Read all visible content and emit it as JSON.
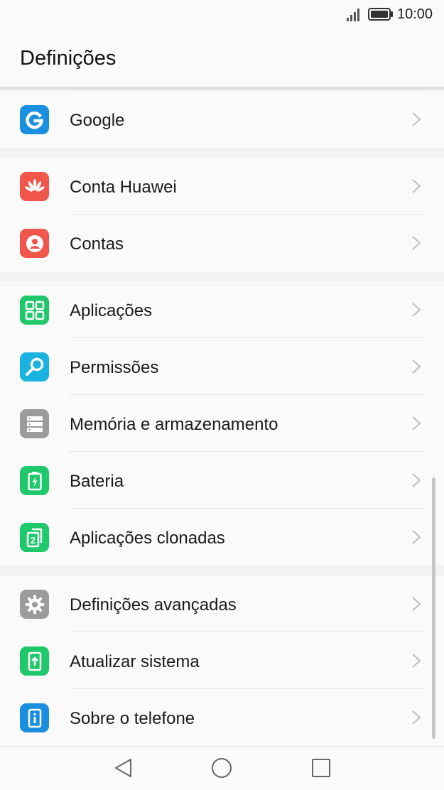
{
  "status_bar": {
    "time": "10:00",
    "signal_icon": "signal-icon",
    "battery_icon": "battery-icon"
  },
  "header": {
    "title": "Definições"
  },
  "groups": [
    {
      "items": [
        {
          "label": "Google",
          "icon": "google-icon",
          "color": "#1a8fe0"
        }
      ]
    },
    {
      "items": [
        {
          "label": "Conta Huawei",
          "icon": "huawei-icon",
          "color": "#f0574a"
        },
        {
          "label": "Contas",
          "icon": "account-icon",
          "color": "#f0574a"
        }
      ]
    },
    {
      "items": [
        {
          "label": "Aplicações",
          "icon": "apps-icon",
          "color": "#1fc96b"
        },
        {
          "label": "Permissões",
          "icon": "key-icon",
          "color": "#1ab2e0"
        },
        {
          "label": "Memória e armazenamento",
          "icon": "storage-icon",
          "color": "#9b9b9b"
        },
        {
          "label": "Bateria",
          "icon": "battery-settings-icon",
          "color": "#1fc96b"
        },
        {
          "label": "Aplicações clonadas",
          "icon": "clone-icon",
          "color": "#1fc96b"
        }
      ]
    },
    {
      "items": [
        {
          "label": "Definições avançadas",
          "icon": "gear-icon",
          "color": "#9b9b9b"
        },
        {
          "label": "Atualizar sistema",
          "icon": "update-icon",
          "color": "#1fc96b"
        },
        {
          "label": "Sobre o telefone",
          "icon": "info-icon",
          "color": "#1a8fe0"
        }
      ]
    }
  ],
  "nav_bar": {
    "back": "back-icon",
    "home": "home-icon",
    "recents": "recents-icon"
  }
}
